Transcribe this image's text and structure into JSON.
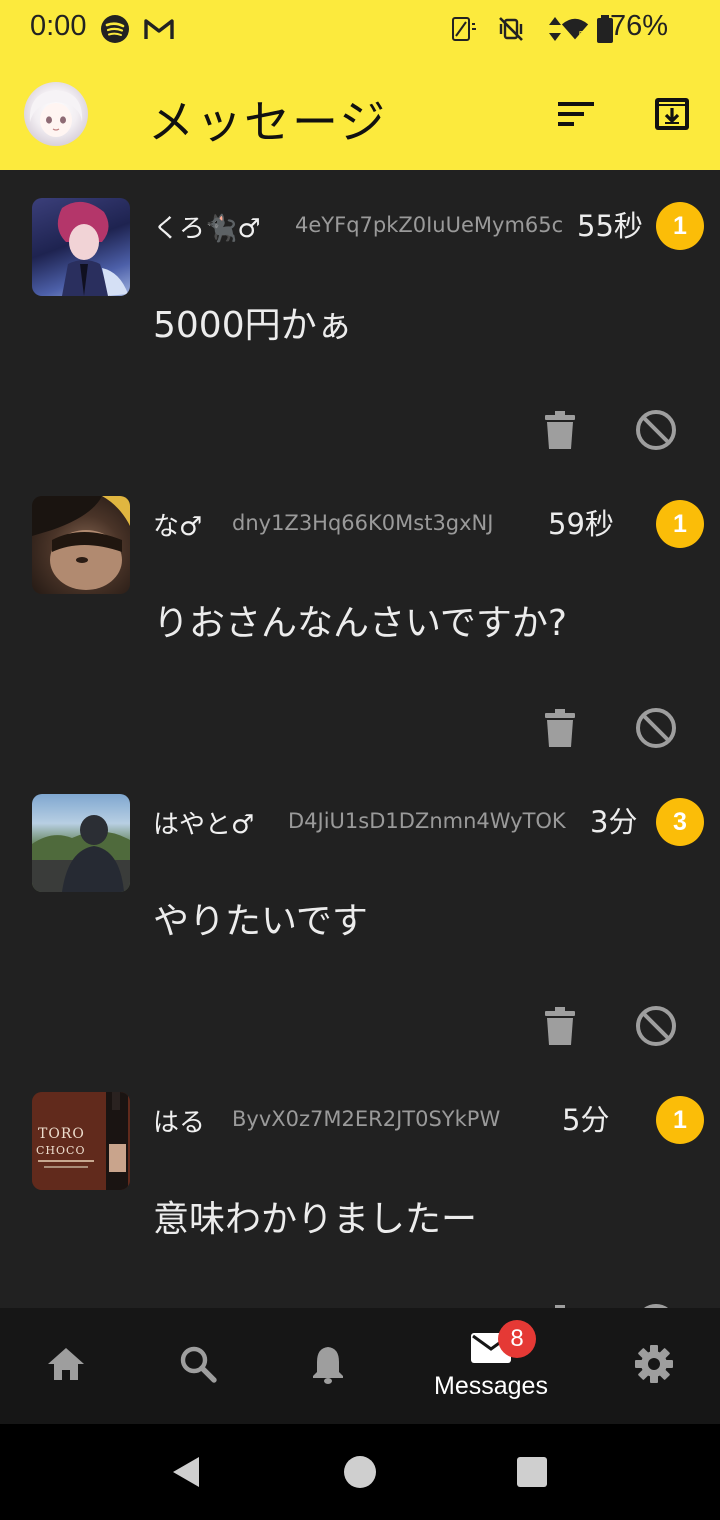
{
  "status_bar": {
    "time": "0:00",
    "battery_pct": "76%",
    "icons": [
      "spotify-icon",
      "gmail-icon",
      "screen-rotate-icon",
      "vibrate-off-icon",
      "data-arrows-icon",
      "wifi-icon",
      "battery-icon"
    ]
  },
  "app_bar": {
    "title": "メッセージ",
    "actions": [
      "sort-icon",
      "archive-download-icon"
    ]
  },
  "conversations": [
    {
      "name": "くろ🐈‍⬛♂",
      "user_id": "4eYFq7pkZ0IuUeMym65c",
      "time": "55秒",
      "unread": "1",
      "message": "5000円かぁ"
    },
    {
      "name": "な♂",
      "user_id": "dny1Z3Hq66K0Mst3gxNJ",
      "time": "59秒",
      "unread": "1",
      "message": "りおさんなんさいですか?"
    },
    {
      "name": "はやと♂",
      "user_id": "D4JiU1sD1DZnmn4WyTOK",
      "time": "3分",
      "unread": "3",
      "message": "やりたいです"
    },
    {
      "name": "はる",
      "user_id": "ByvX0z7M2ER2JT0SYkPW",
      "time": "5分",
      "unread": "1",
      "message": "意味わかりましたー"
    }
  ],
  "thumbnail_text": {
    "line1": "TORO",
    "line2": "CHOCO"
  },
  "bottom_nav": {
    "items": [
      "home-icon",
      "search-icon",
      "bell-icon",
      "mail-icon",
      "gear-icon"
    ],
    "active_label": "Messages",
    "messages_badge": "8"
  },
  "colors": {
    "accent": "#fcea3d",
    "badge": "#fbbd08",
    "background": "#212121",
    "nav_badge": "#e53935"
  }
}
